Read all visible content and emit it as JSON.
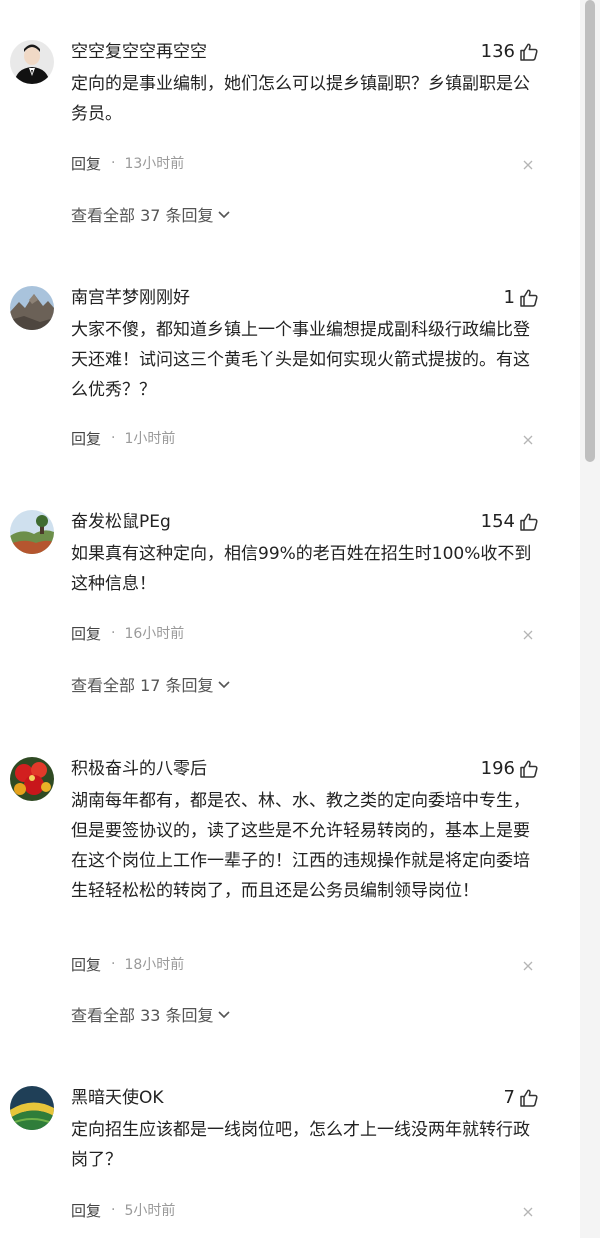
{
  "comments": [
    {
      "username": "空空复空空再空空",
      "likes": "136",
      "content": "定向的是事业编制，她们怎么可以提乡镇副职？乡镇副职是公务员。",
      "reply_label": "回复",
      "separator": "·",
      "time": "13小时前",
      "view_all": "查看全部 37 条回复",
      "avatar_icon": "user-avatar-suit-icon"
    },
    {
      "username": "南宫芊梦刚刚好",
      "likes": "1",
      "content": "大家不傻，都知道乡镇上一个事业编想提成副科级行政编比登天还难！试问这三个黄毛丫头是如何实现火箭式提拔的。有这么优秀？？",
      "reply_label": "回复",
      "separator": "·",
      "time": "1小时前",
      "avatar_icon": "user-avatar-mountain-icon"
    },
    {
      "username": "奋发松鼠PEg",
      "likes": "154",
      "content": "如果真有这种定向，相信99%的老百姓在招生时100%收不到这种信息！",
      "reply_label": "回复",
      "separator": "·",
      "time": "16小时前",
      "view_all": "查看全部 17 条回复",
      "avatar_icon": "user-avatar-landscape-icon"
    },
    {
      "username": "积极奋斗的八零后",
      "likes": "196",
      "content": "湖南每年都有，都是农、林、水、教之类的定向委培中专生，但是要签协议的，读了这些是不允许轻易转岗的，基本上是要在这个岗位上工作一辈子的！江西的违规操作就是将定向委培生轻轻松松的转岗了，而且还是公务员编制领导岗位！",
      "reply_label": "回复",
      "separator": "·",
      "time": "18小时前",
      "view_all": "查看全部 33 条回复",
      "avatar_icon": "user-avatar-flowers-icon"
    },
    {
      "username": "黑暗天使OK",
      "likes": "7",
      "content": "定向招生应该都是一线岗位吧，怎么才上一线没两年就转行政岗了？",
      "reply_label": "回复",
      "separator": "·",
      "time": "5小时前",
      "avatar_icon": "user-avatar-fields-icon"
    }
  ],
  "colors": {
    "text": "#222222",
    "meta": "#9a9a9a",
    "scrollbar_thumb": "#bfbfbf"
  }
}
